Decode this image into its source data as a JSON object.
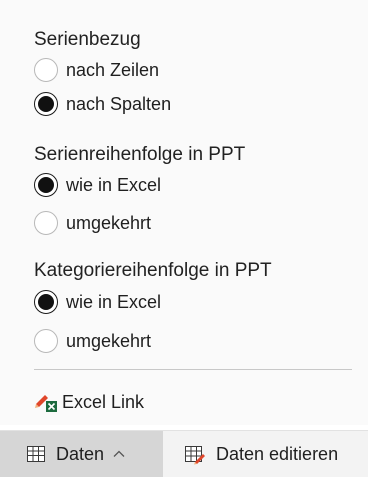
{
  "serienbezug": {
    "title": "Serienbezug",
    "options": [
      {
        "label": "nach Zeilen",
        "checked": false
      },
      {
        "label": "nach Spalten",
        "checked": true
      }
    ]
  },
  "serienreihenfolge": {
    "title": "Serienreihenfolge in PPT",
    "options": [
      {
        "label": "wie in Excel",
        "checked": true
      },
      {
        "label": "umgekehrt",
        "checked": false
      }
    ]
  },
  "kategoriereihenfolge": {
    "title": "Kategoriereihenfolge in PPT",
    "options": [
      {
        "label": "wie in Excel",
        "checked": true
      },
      {
        "label": "umgekehrt",
        "checked": false
      }
    ]
  },
  "excel_link": {
    "label": "Excel Link",
    "icon": "excel-link-icon"
  },
  "bottom_bar": {
    "daten_tab": {
      "label": "Daten",
      "icon": "table-icon",
      "chevron": "chevron-up-icon"
    },
    "edit_tab": {
      "label": "Daten editieren",
      "icon": "edit-table-icon"
    }
  },
  "colors": {
    "accent_pencil": "#e0462a",
    "excel_green": "#1d6b3f",
    "selected_tab": "#d6d6d6"
  }
}
